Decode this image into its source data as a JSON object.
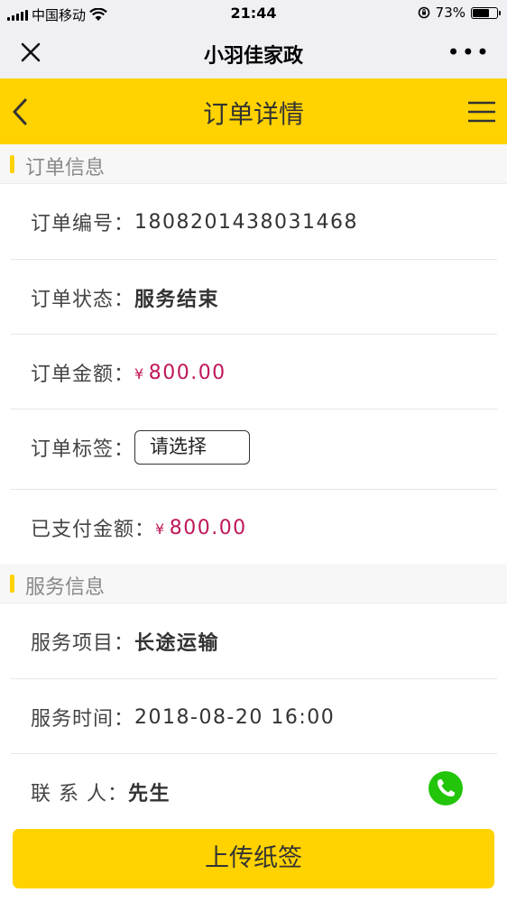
{
  "status_bar": {
    "carrier": "中国移动",
    "time": "21:44",
    "battery_percent": "73%",
    "battery_level": 0.73
  },
  "wechat_header": {
    "title": "小羽佳家政",
    "more": "•••"
  },
  "app_header": {
    "title": "订单详情"
  },
  "order_section": {
    "title": "订单信息",
    "rows": {
      "number_label": "订单编号：",
      "number_value": "1808201438031468",
      "status_label": "订单状态：",
      "status_value": "服务结束",
      "amount_label": "订单金额：",
      "amount_currency": "¥",
      "amount_value": "800.00",
      "tag_label": "订单标签：",
      "tag_select_value": "请选择",
      "paid_label": "已支付金额：",
      "paid_currency": "¥",
      "paid_value": "800.00"
    }
  },
  "service_section": {
    "title": "服务信息",
    "rows": {
      "item_label": "服务项目：",
      "item_value": "长途运输",
      "time_label": "服务时间：",
      "time_value": "2018-08-20 16:00",
      "contact_label": "联 系 人：",
      "contact_value": "先生"
    }
  },
  "bottom_button": {
    "label": "上传纸签"
  },
  "colors": {
    "accent": "#ffd200",
    "money": "#c0175b",
    "phone": "#22c50a"
  }
}
